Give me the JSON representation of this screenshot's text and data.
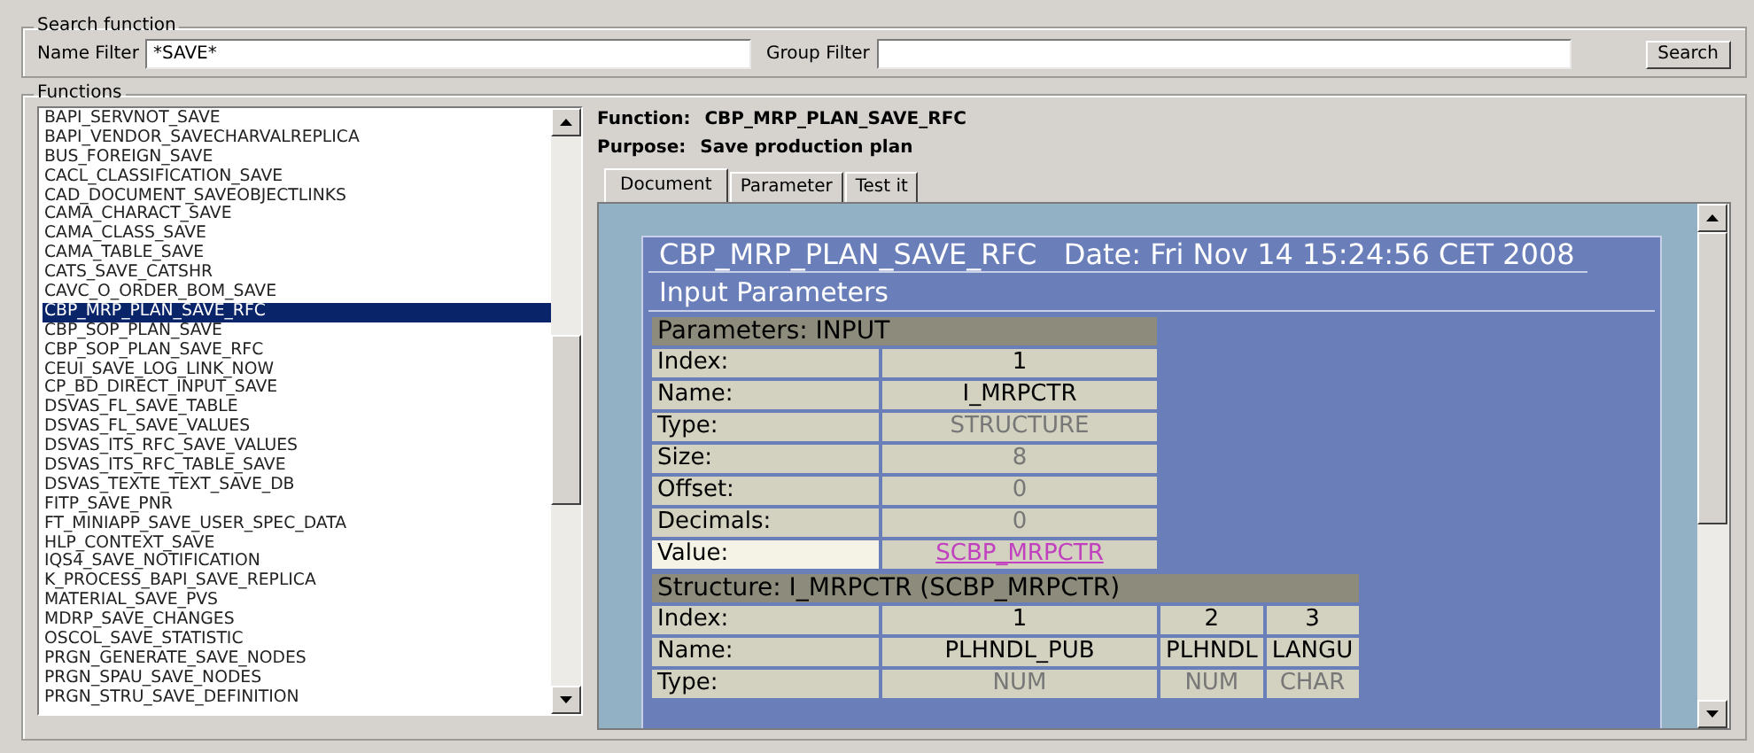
{
  "search": {
    "title": "Search function",
    "name_filter": {
      "label": "Name Filter",
      "value": "*SAVE*"
    },
    "group_filter": {
      "label": "Group Filter"
    },
    "button": "Search"
  },
  "functions": {
    "title": "Functions",
    "items": [
      {
        "label": "BAPI_SERVNOT_SAVE",
        "selected": false
      },
      {
        "label": "BAPI_VENDOR_SAVECHARVALREPLICA",
        "selected": false
      },
      {
        "label": "BUS_FOREIGN_SAVE",
        "selected": false
      },
      {
        "label": "CACL_CLASSIFICATION_SAVE",
        "selected": false
      },
      {
        "label": "CAD_DOCUMENT_SAVEOBJECTLINKS",
        "selected": false
      },
      {
        "label": "CAMA_CHARACT_SAVE",
        "selected": false
      },
      {
        "label": "CAMA_CLASS_SAVE",
        "selected": false
      },
      {
        "label": "CAMA_TABLE_SAVE",
        "selected": false
      },
      {
        "label": "CATS_SAVE_CATSHR",
        "selected": false
      },
      {
        "label": "CAVC_O_ORDER_BOM_SAVE",
        "selected": false
      },
      {
        "label": "CBP_MRP_PLAN_SAVE_RFC",
        "selected": true
      },
      {
        "label": "CBP_SOP_PLAN_SAVE",
        "selected": false
      },
      {
        "label": "CBP_SOP_PLAN_SAVE_RFC",
        "selected": false
      },
      {
        "label": "CEUI_SAVE_LOG_LINK_NOW",
        "selected": false
      },
      {
        "label": "CP_BD_DIRECT_INPUT_SAVE",
        "selected": false
      },
      {
        "label": "DSVAS_FL_SAVE_TABLE",
        "selected": false
      },
      {
        "label": "DSVAS_FL_SAVE_VALUES",
        "selected": false
      },
      {
        "label": "DSVAS_ITS_RFC_SAVE_VALUES",
        "selected": false
      },
      {
        "label": "DSVAS_ITS_RFC_TABLE_SAVE",
        "selected": false
      },
      {
        "label": "DSVAS_TEXTE_TEXT_SAVE_DB",
        "selected": false
      },
      {
        "label": "FITP_SAVE_PNR",
        "selected": false
      },
      {
        "label": "FT_MINIAPP_SAVE_USER_SPEC_DATA",
        "selected": false
      },
      {
        "label": "HLP_CONTEXT_SAVE",
        "selected": false
      },
      {
        "label": "IQS4_SAVE_NOTIFICATION",
        "selected": false
      },
      {
        "label": "K_PROCESS_BAPI_SAVE_REPLICA",
        "selected": false
      },
      {
        "label": "MATERIAL_SAVE_PVS",
        "selected": false
      },
      {
        "label": "MDRP_SAVE_CHANGES",
        "selected": false
      },
      {
        "label": "OSCOL_SAVE_STATISTIC",
        "selected": false
      },
      {
        "label": "PRGN_GENERATE_SAVE_NODES",
        "selected": false
      },
      {
        "label": "PRGN_SPAU_SAVE_NODES",
        "selected": false
      },
      {
        "label": "PRGN_STRU_SAVE_DEFINITION",
        "selected": false
      }
    ]
  },
  "detail": {
    "function_label": "Function:",
    "function_value": "CBP_MRP_PLAN_SAVE_RFC",
    "purpose_label": "Purpose:",
    "purpose_value": "Save production plan",
    "tabs": [
      {
        "label": "Document",
        "selected": true
      },
      {
        "label": "Parameter",
        "selected": false
      },
      {
        "label": "Test it",
        "selected": false
      }
    ],
    "document": {
      "header": "CBP_MRP_PLAN_SAVE_RFC   Date: Fri Nov 14 15:24:56 CET 2008",
      "section": "Input Parameters",
      "parameters_table": {
        "title": "Parameters: INPUT",
        "rows": [
          {
            "label": "Index:",
            "value": "1",
            "kind": "plain"
          },
          {
            "label": "Name:",
            "value": "I_MRPCTR",
            "kind": "plain"
          },
          {
            "label": "Type:",
            "value": "STRUCTURE",
            "kind": "muted"
          },
          {
            "label": "Size:",
            "value": "8",
            "kind": "muted"
          },
          {
            "label": "Offset:",
            "value": "0",
            "kind": "muted"
          },
          {
            "label": "Decimals:",
            "value": "0",
            "kind": "muted"
          },
          {
            "label": "Value:",
            "value": "SCBP_MRPCTR",
            "kind": "link"
          }
        ]
      },
      "structure_table": {
        "title": "Structure: I_MRPCTR (SCBP_MRPCTR)",
        "rows": [
          {
            "label": "Index:",
            "values": [
              "1",
              "2",
              "3"
            ],
            "kind": "plain"
          },
          {
            "label": "Name:",
            "values": [
              "PLHNDL_PUB",
              "PLHNDL",
              "LANGU"
            ],
            "kind": "plain"
          },
          {
            "label": "Type:",
            "values": [
              "NUM",
              "NUM",
              "CHAR"
            ],
            "kind": "muted"
          }
        ]
      }
    }
  }
}
